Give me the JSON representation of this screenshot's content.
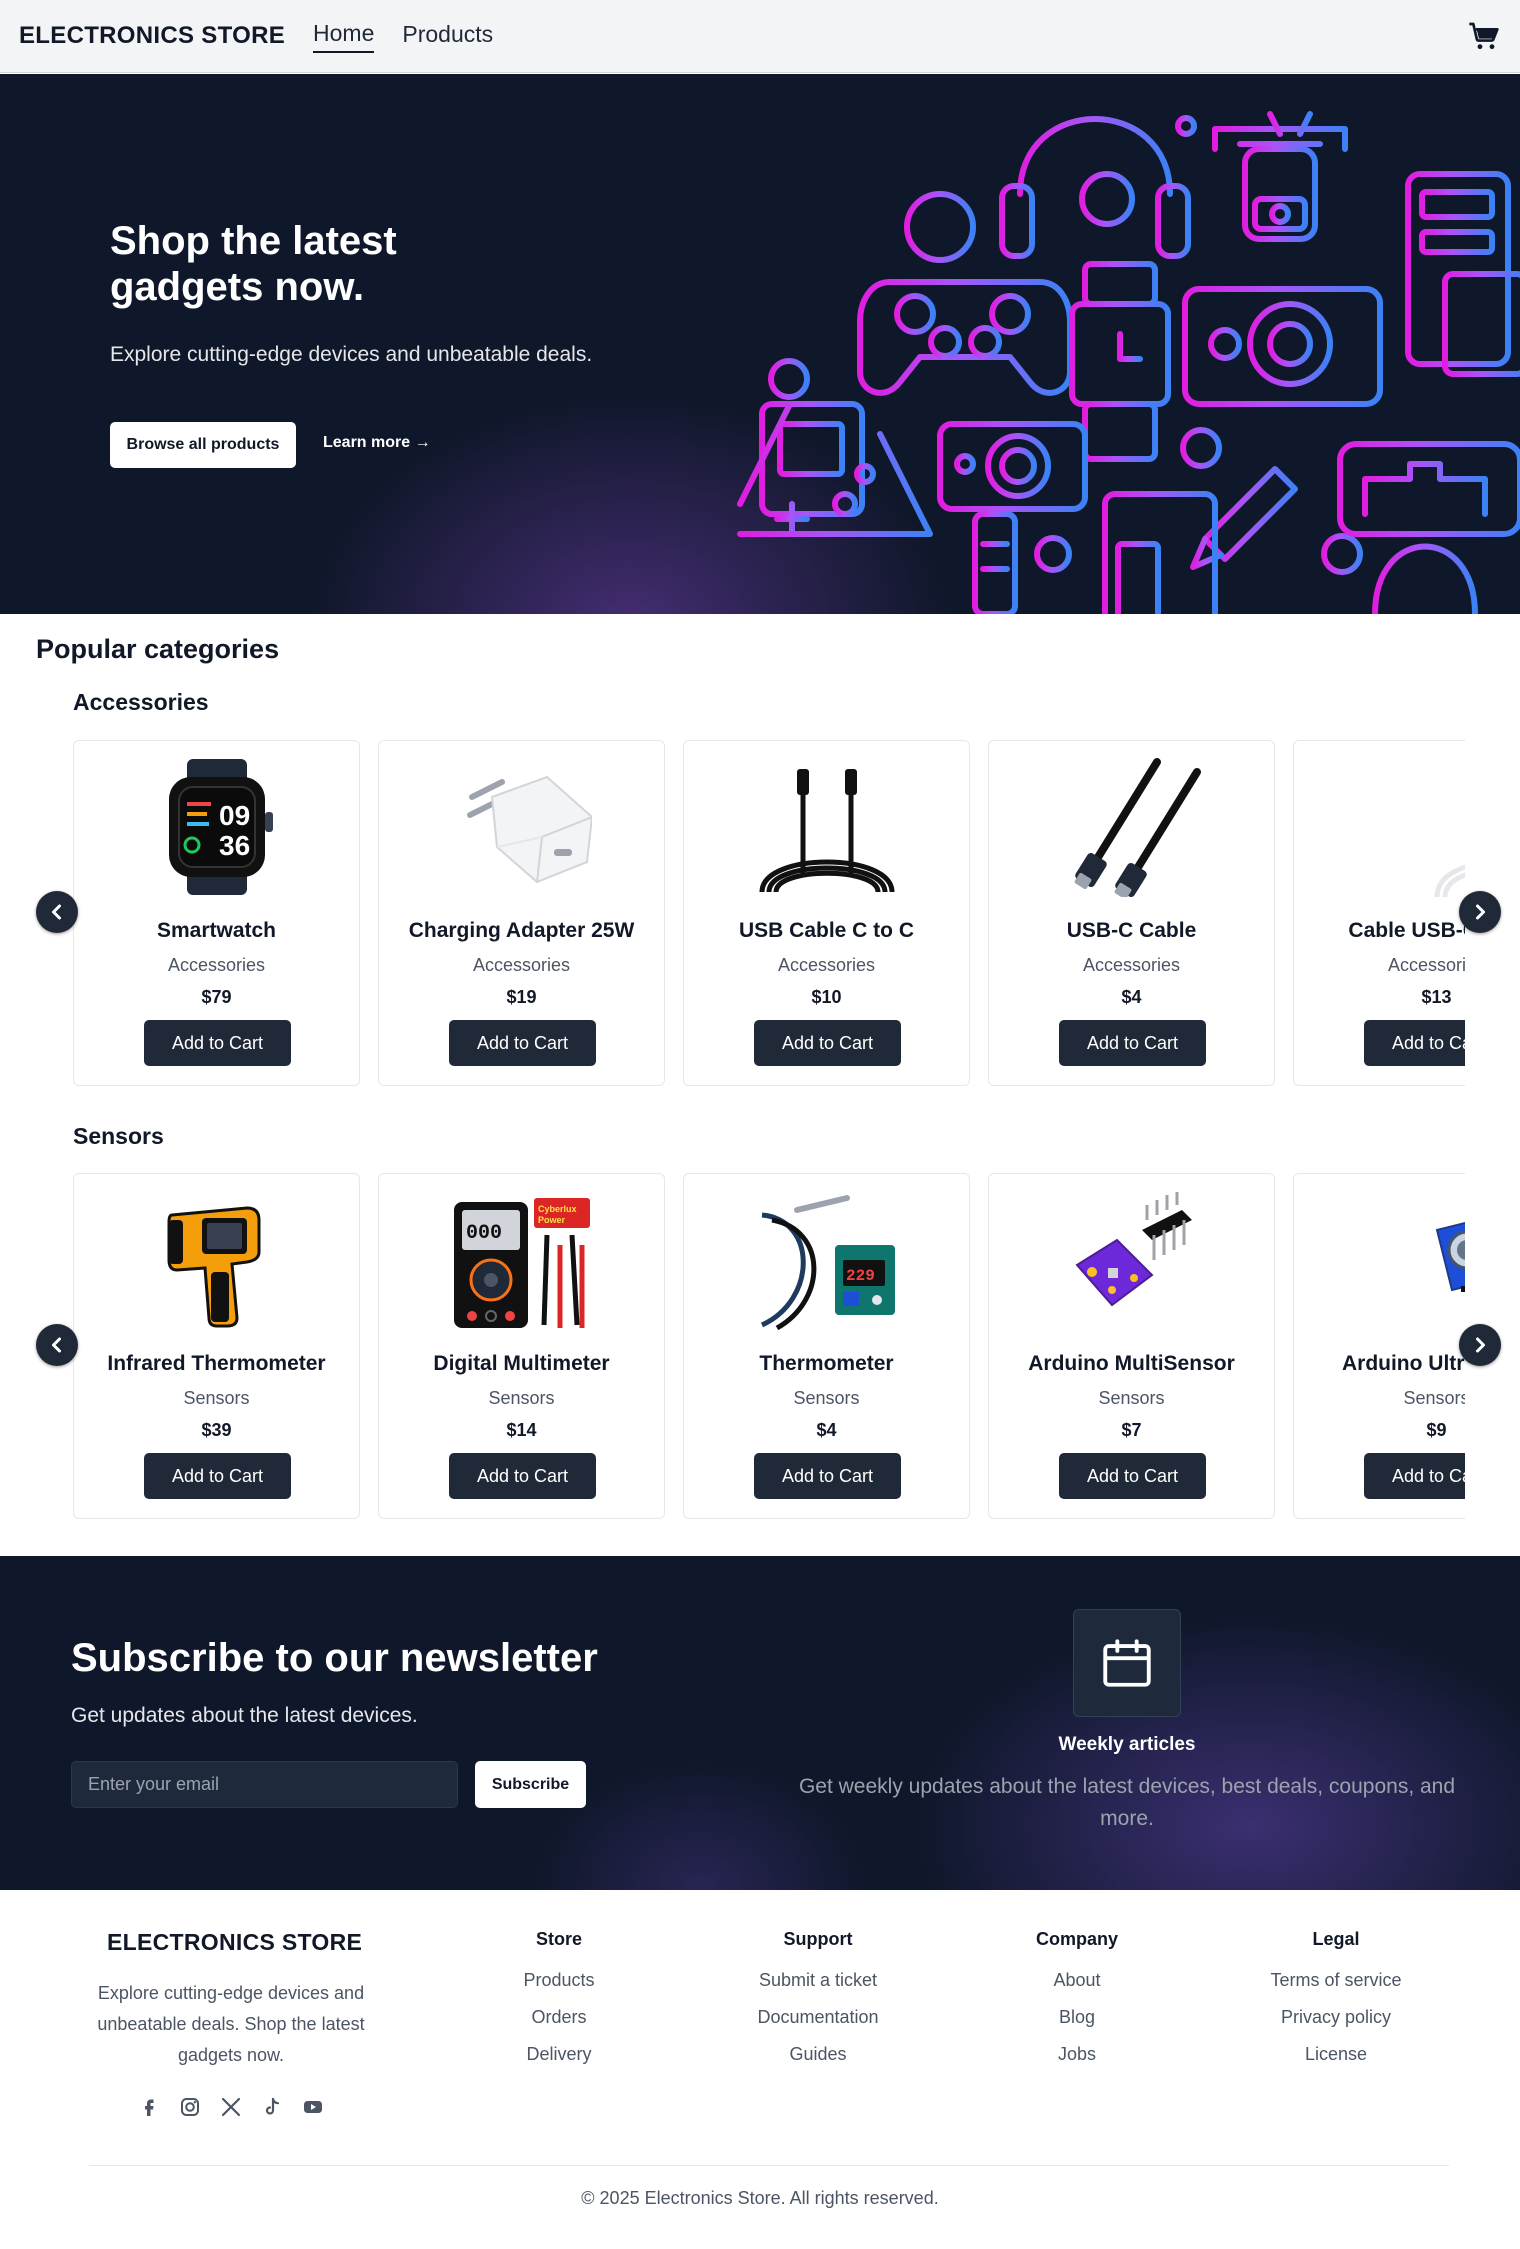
{
  "header": {
    "brand": "ELECTRONICS STORE",
    "nav": [
      "Home",
      "Products"
    ],
    "active_nav": "Home",
    "cart_icon": "shopping-cart-icon"
  },
  "hero": {
    "title": "Shop the latest gadgets now.",
    "subtitle": "Explore cutting-edge devices and unbeatable deals.",
    "primary_button": "Browse all products",
    "secondary_link": "Learn more →",
    "art_icons": [
      "headphones-icon",
      "game-controller-icon",
      "smartwatch-icon",
      "camera-icon",
      "drone-icon",
      "handheld-console-icon",
      "monitor-icon",
      "vr-headset-icon",
      "mouse-icon",
      "stylus-icon"
    ],
    "art_colors": [
      "#e11de0",
      "#a855f7",
      "#3b82f6"
    ]
  },
  "categories": {
    "title": "Popular categories",
    "groups": [
      {
        "name": "Accessories",
        "products": [
          {
            "name": "Smartwatch",
            "category": "Accessories",
            "price": "$79",
            "button": "Add to Cart",
            "image": "smartwatch-image"
          },
          {
            "name": "Charging Adapter 25W",
            "category": "Accessories",
            "price": "$19",
            "button": "Add to Cart",
            "image": "charging-adapter-image"
          },
          {
            "name": "USB Cable C to C",
            "category": "Accessories",
            "price": "$10",
            "button": "Add to Cart",
            "image": "usb-cable-image"
          },
          {
            "name": "USB-C Cable",
            "category": "Accessories",
            "price": "$4",
            "button": "Add to Cart",
            "image": "usb-c-cable-image"
          },
          {
            "name": "Cable USB-C to C",
            "category": "Accessories",
            "price": "$13",
            "button": "Add to Cart",
            "image": "white-cable-image"
          }
        ]
      },
      {
        "name": "Sensors",
        "products": [
          {
            "name": "Infrared Thermometer",
            "category": "Sensors",
            "price": "$39",
            "button": "Add to Cart",
            "image": "infrared-thermometer-image"
          },
          {
            "name": "Digital Multimeter",
            "category": "Sensors",
            "price": "$14",
            "button": "Add to Cart",
            "image": "multimeter-image"
          },
          {
            "name": "Thermometer",
            "category": "Sensors",
            "price": "$4",
            "button": "Add to Cart",
            "image": "thermometer-module-image"
          },
          {
            "name": "Arduino MultiSensor",
            "category": "Sensors",
            "price": "$7",
            "button": "Add to Cart",
            "image": "sensor-board-image"
          },
          {
            "name": "Arduino Ultrasonic",
            "category": "Sensors",
            "price": "$9",
            "button": "Add to Cart",
            "image": "ultrasonic-sensor-image"
          }
        ]
      }
    ],
    "prev_icon": "chevron-left-icon",
    "next_icon": "chevron-right-icon"
  },
  "newsletter": {
    "title": "Subscribe to our newsletter",
    "subtitle": "Get updates about the latest devices.",
    "email_placeholder": "Enter your email",
    "button": "Subscribe",
    "feature_icon": "calendar-icon",
    "feature_title": "Weekly articles",
    "feature_text": "Get weekly updates about the latest devices, best deals, coupons, and more."
  },
  "footer": {
    "brand": "ELECTRONICS STORE",
    "description": "Explore cutting-edge devices and unbeatable deals. Shop the latest gadgets now.",
    "socials": [
      "facebook-icon",
      "instagram-icon",
      "x-icon",
      "tiktok-icon",
      "youtube-icon"
    ],
    "columns": [
      {
        "title": "Store",
        "links": [
          "Products",
          "Orders",
          "Delivery"
        ]
      },
      {
        "title": "Support",
        "links": [
          "Submit a ticket",
          "Documentation",
          "Guides"
        ]
      },
      {
        "title": "Company",
        "links": [
          "About",
          "Blog",
          "Jobs"
        ]
      },
      {
        "title": "Legal",
        "links": [
          "Terms of service",
          "Privacy policy",
          "License"
        ]
      }
    ],
    "copyright": "© 2025 Electronics Store. All rights reserved."
  },
  "colors": {
    "dark": "#0f172a",
    "button_dark": "#1f2937",
    "header_bg": "#f3f4f6"
  }
}
